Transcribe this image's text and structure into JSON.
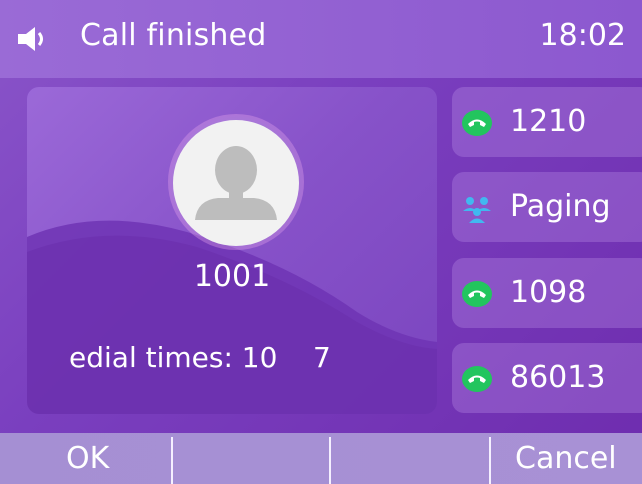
{
  "status_bar": {
    "title": "Call finished",
    "time": "18:02",
    "icon": "speaker-icon"
  },
  "call": {
    "avatar_icon": "contact-avatar-icon",
    "number": "1001",
    "redial_text": "edial times: 10    7"
  },
  "line_keys": [
    {
      "label": "1210",
      "icon": "handset-green-icon"
    },
    {
      "label": "Paging",
      "icon": "paging-group-icon"
    },
    {
      "label": "1098",
      "icon": "handset-green-icon"
    },
    {
      "label": "86013",
      "icon": "handset-green-icon"
    }
  ],
  "softkeys": {
    "ok": "OK",
    "cancel": "Cancel"
  },
  "colors": {
    "background": "#7a3fbf",
    "top_bar": "#9a6bd6",
    "softkey_bar": "#a58fd3",
    "call_green": "#22c55e",
    "paging_blue": "#41b8f0"
  }
}
